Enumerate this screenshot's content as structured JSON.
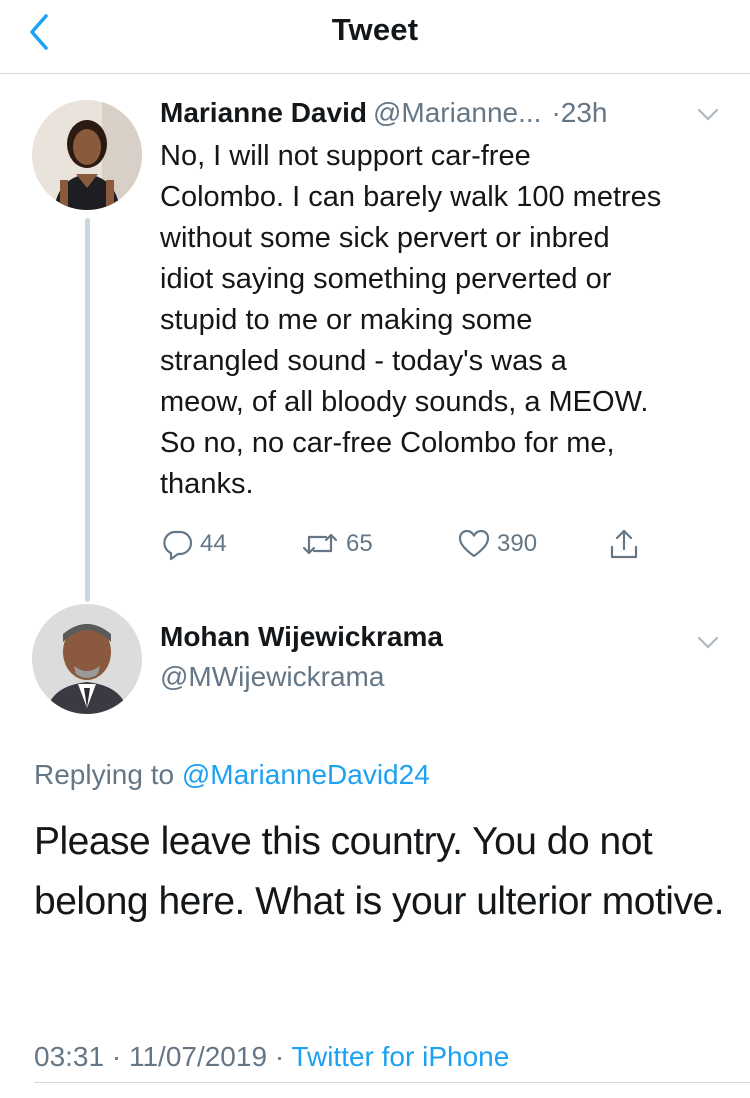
{
  "header": {
    "title": "Tweet",
    "back_icon": "chevron-left-icon"
  },
  "colors": {
    "accent": "#1da1f2",
    "secondary_text": "#657786",
    "primary_text": "#14171a",
    "divider": "#d4d8dc"
  },
  "tweet1": {
    "name": "Marianne David",
    "handle": "@Marianne...",
    "dot": "·",
    "time": "23h",
    "text": "No, I will not support car-free\nColombo. I can barely walk 100 metres\nwithout some sick pervert or inbred\nidiot saying something perverted or\nstupid to me or making some\nstrangled sound - today's was a\nmeow, of all bloody sounds, a MEOW.\nSo no, no car-free Colombo for me,\nthanks.",
    "actions": {
      "replies": "44",
      "retweets": "65",
      "likes": "390"
    }
  },
  "tweet2": {
    "name": "Mohan Wijewickrama",
    "handle": "@MWijewickrama",
    "replying_prefix": "Replying to",
    "replying_to": "@MarianneDavid24",
    "text": "Please leave this country. You do not belong here. What is your ulterior motive.",
    "time": "03:31",
    "sep1": "·",
    "date": "11/07/2019",
    "sep2": "·",
    "source": "Twitter for iPhone"
  }
}
